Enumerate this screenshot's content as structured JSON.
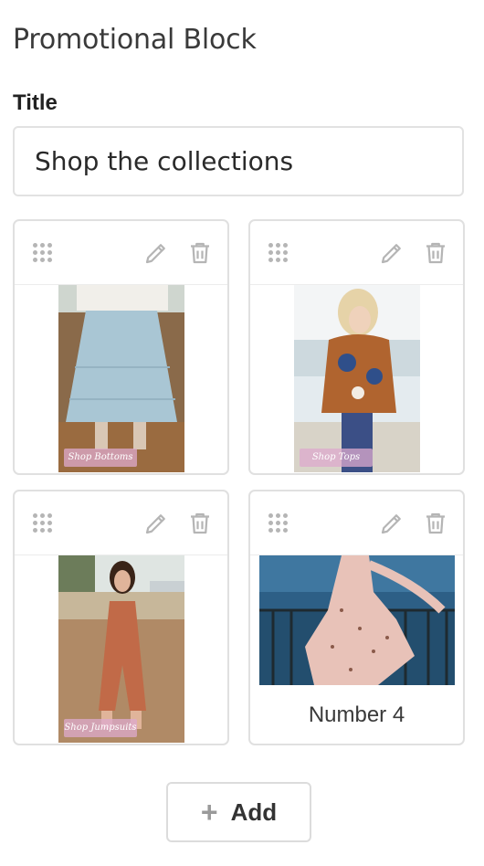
{
  "block": {
    "title": "Promotional Block",
    "title_field_label": "Title",
    "title_value": "Shop the collections"
  },
  "cards": [
    {
      "caption": "",
      "image": "blue-tiered-skirt-photo",
      "watermark": "Shop Bottoms"
    },
    {
      "caption": "",
      "image": "floral-tunic-top-photo",
      "watermark": "Shop Tops"
    },
    {
      "caption": "",
      "image": "rust-jumpsuit-photo",
      "watermark": "Shop Jumpsuits"
    },
    {
      "caption": "Number 4",
      "image": "pink-wrap-dress-photo",
      "watermark": ""
    }
  ],
  "icons": {
    "drag": "drag-handle-icon",
    "edit": "pencil-icon",
    "delete": "trash-icon",
    "add": "plus-icon"
  },
  "colors": {
    "border": "#e0e0e0",
    "icon": "#b5b5b5",
    "text": "#333333"
  },
  "add_button": {
    "label": "Add",
    "icon": "+"
  }
}
